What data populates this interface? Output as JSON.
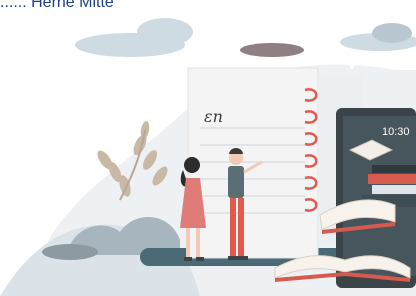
{
  "header": {
    "text": "...... Herne Mitte"
  },
  "notebook": {
    "scribble": "ɛn"
  },
  "phone": {
    "time": "10:30"
  }
}
